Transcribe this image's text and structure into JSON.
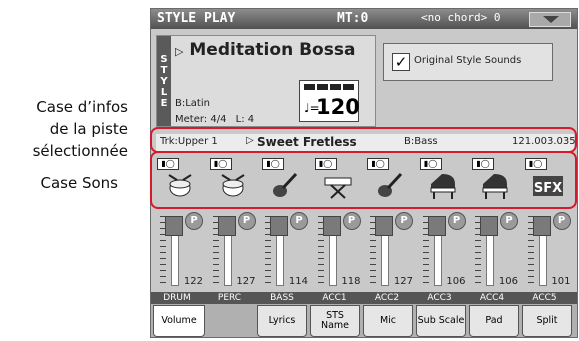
{
  "annotations": {
    "track_info": [
      "Case d’infos",
      "de la piste",
      "sélectionnée"
    ],
    "sounds": "Case Sons"
  },
  "titlebar": {
    "mode": "STYLE PLAY",
    "mt": "MT:0",
    "chord": "<no chord> 0"
  },
  "style": {
    "tab_letters": [
      "S",
      "T",
      "Y",
      "L",
      "E"
    ],
    "name": "Meditation Bossa",
    "bank": "B:Latin",
    "meter": "Meter: 4/4",
    "length": "L: 4",
    "tempo_note": "♩=",
    "tempo": "120"
  },
  "original_sounds": {
    "label": "Original Style Sounds",
    "checked": true
  },
  "track_info": {
    "track": "Trk:Upper 1",
    "sound": "Sweet Fretless",
    "bank": "B:Bass",
    "number": "121.003.035"
  },
  "sounds": [
    {
      "icon": "drum-kit-icon"
    },
    {
      "icon": "drum-kit-icon"
    },
    {
      "icon": "guitar-icon"
    },
    {
      "icon": "keyboard-stand-icon"
    },
    {
      "icon": "guitar-icon"
    },
    {
      "icon": "grand-piano-icon"
    },
    {
      "icon": "grand-piano-icon"
    },
    {
      "icon": "sfx-icon",
      "text": "SFX"
    }
  ],
  "mixer": {
    "values": [
      "122",
      "127",
      "114",
      "118",
      "127",
      "106",
      "106",
      "101"
    ],
    "labels": [
      "DRUM",
      "PERC",
      "BASS",
      "ACC1",
      "ACC2",
      "ACC3",
      "ACC4",
      "ACC5"
    ],
    "play_label": "P"
  },
  "tabs": [
    "Volume",
    "Lyrics",
    "STS Name",
    "Mic",
    "Sub Scale",
    "Pad",
    "Split"
  ],
  "colors": {
    "highlight": "#d7192c"
  }
}
